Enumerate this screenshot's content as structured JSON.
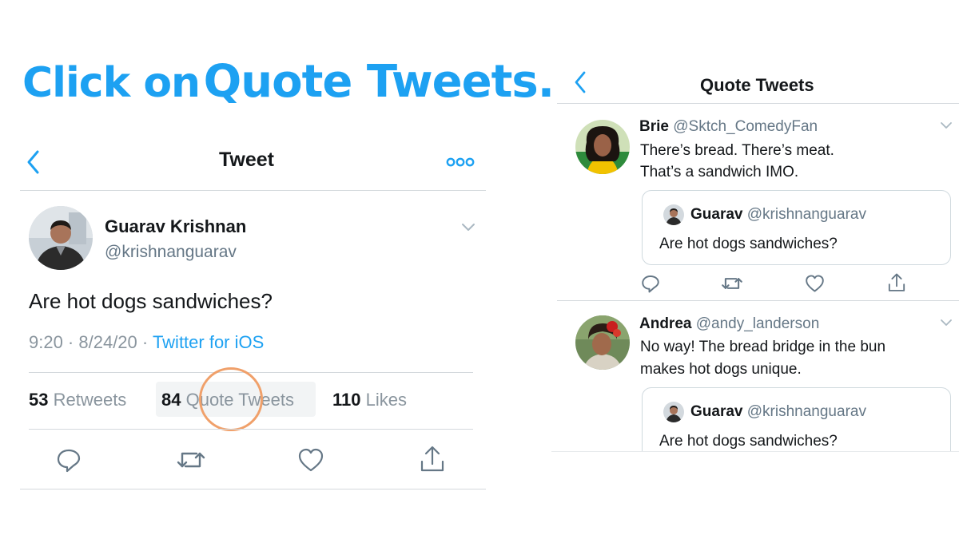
{
  "headline": {
    "part1": "Click on",
    "part2": "Quote Tweets."
  },
  "left": {
    "title": "Tweet",
    "tweet": {
      "author_name": "Guarav Krishnan",
      "handle": "@krishnanguarav",
      "text": "Are hot dogs sandwiches?",
      "time_date": "9:20 · 8/24/20 · ",
      "source": "Twitter for iOS"
    },
    "stats": {
      "retweets_count": "53",
      "retweets_label": " Retweets",
      "quotes_count": "84",
      "quotes_label": " Quote Tweets",
      "likes_count": "110",
      "likes_label": " Likes"
    }
  },
  "right": {
    "title": "Quote Tweets",
    "items": [
      {
        "name": "Brie",
        "handle": "@Sktch_ComedyFan",
        "line1": "There’s bread. There’s meat.",
        "line2": "That’s a sandwich IMO.",
        "quoted_name": "Guarav",
        "quoted_handle": "@krishnanguarav",
        "quoted_text": "Are hot dogs sandwiches?"
      },
      {
        "name": "Andrea",
        "handle": "@andy_landerson",
        "line1": "No way! The bread bridge in the bun",
        "line2": "makes hot dogs unique.",
        "quoted_name": "Guarav",
        "quoted_handle": "@krishnanguarav",
        "quoted_text": "Are hot dogs sandwiches?"
      }
    ]
  },
  "colors": {
    "accent": "#1da1f2",
    "highlight_circle": "#f0a06a",
    "text_secondary": "#657786"
  }
}
